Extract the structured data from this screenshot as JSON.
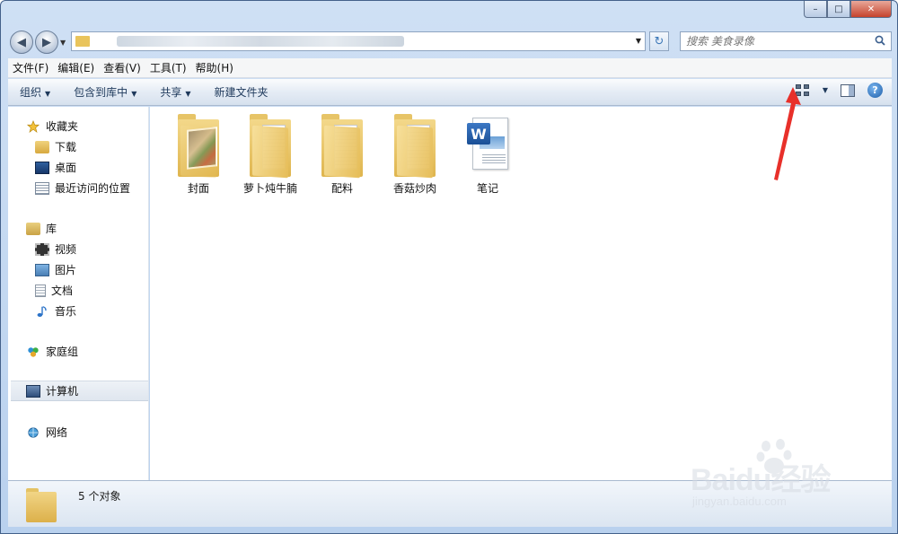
{
  "window": {
    "caption_min": "–",
    "caption_max": "□",
    "caption_close": "✕"
  },
  "address": {
    "search_placeholder": "搜索 美食录像"
  },
  "menu": [
    {
      "label": "文件(F)"
    },
    {
      "label": "编辑(E)"
    },
    {
      "label": "查看(V)"
    },
    {
      "label": "工具(T)"
    },
    {
      "label": "帮助(H)"
    }
  ],
  "commands": {
    "organize": "组织",
    "include_library": "包含到库中",
    "share": "共享",
    "new_folder": "新建文件夹"
  },
  "nav": {
    "favorites": {
      "label": "收藏夹",
      "items": [
        "下载",
        "桌面",
        "最近访问的位置"
      ]
    },
    "libraries": {
      "label": "库",
      "items": [
        "视频",
        "图片",
        "文档",
        "音乐"
      ]
    },
    "homegroup": "家庭组",
    "computer": "计算机",
    "network": "网络"
  },
  "files": [
    {
      "name": "封面",
      "type": "folder-photo"
    },
    {
      "name": "萝卜炖牛腩",
      "type": "folder"
    },
    {
      "name": "配料",
      "type": "folder"
    },
    {
      "name": "香菇炒肉",
      "type": "folder"
    },
    {
      "name": "笔记",
      "type": "word-doc"
    }
  ],
  "status": {
    "count_text": "5 个对象"
  },
  "watermark": {
    "logo": "Baidu经验",
    "url": "jingyan.baidu.com"
  },
  "colors": {
    "accent": "#1e395b",
    "annotation": "#e8302a"
  }
}
